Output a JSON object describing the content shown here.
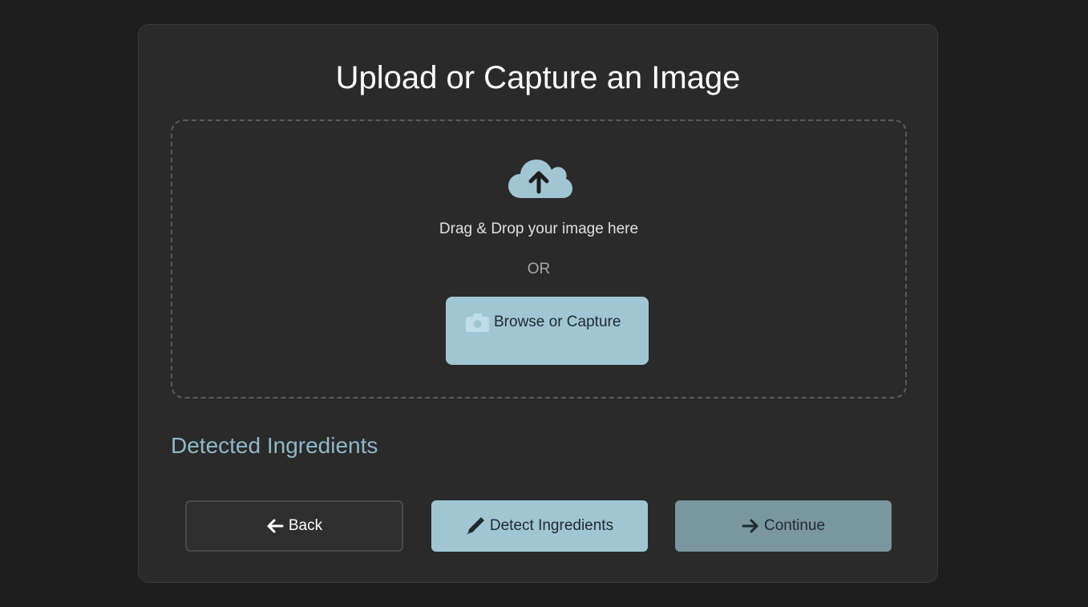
{
  "page": {
    "title": "Upload or Capture an Image"
  },
  "upload": {
    "icon": "cloud-upload-icon",
    "drop_text": "Drag & Drop your image here",
    "or_text": "OR",
    "browse_icon": "camera-icon",
    "browse_label": "Browse or Capture"
  },
  "ingredients": {
    "title": "Detected Ingredients"
  },
  "actions": {
    "back_icon": "arrow-left-icon",
    "back_label": "Back",
    "detect_icon": "pencil-icon",
    "detect_label": "Detect Ingredients",
    "continue_icon": "arrow-right-icon",
    "continue_label": "Continue"
  },
  "colors": {
    "accent": "#a1c6d3",
    "accent_muted": "#7a969f",
    "section_title": "#8fb8c8",
    "background": "#1e1e1e",
    "card": "#2a2a2a"
  }
}
